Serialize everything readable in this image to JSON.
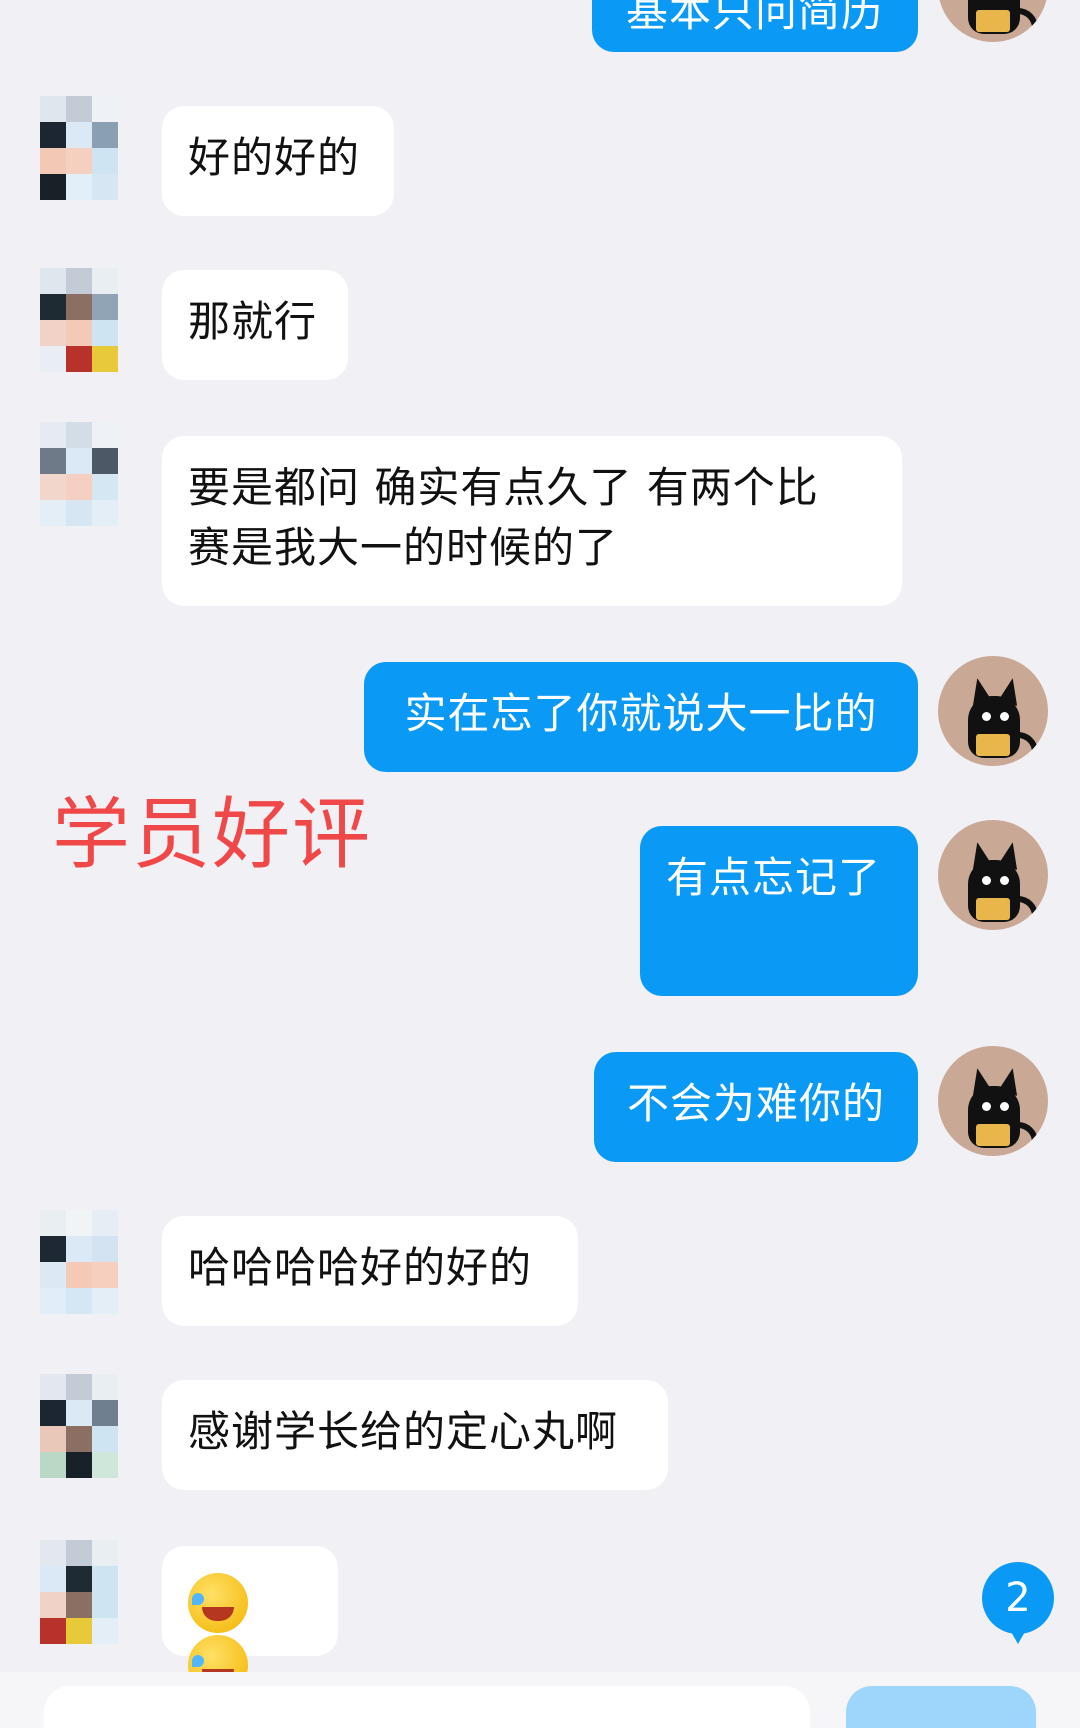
{
  "messages": [
    {
      "side": "out",
      "text": "基本只问简历"
    },
    {
      "side": "in",
      "text": "好的好的"
    },
    {
      "side": "in",
      "text": "那就行"
    },
    {
      "side": "in",
      "line1": "要是都问 确实有点久了 有两个比",
      "line2": "赛是我大一的时候的了"
    },
    {
      "side": "out",
      "text": "实在忘了你就说大一比的"
    },
    {
      "side": "out",
      "text": "有点忘记了"
    },
    {
      "side": "out",
      "text": "不会为难你的"
    },
    {
      "side": "in",
      "text": "哈哈哈哈好的好的"
    },
    {
      "side": "in",
      "text": "感谢学长给的定心丸啊"
    },
    {
      "side": "in",
      "emoji": [
        "rolling-on-floor-laughing",
        "rolling-on-floor-laughing"
      ]
    }
  ],
  "overlay": {
    "text": "学员好评",
    "color": "#f04848"
  },
  "unread_badge": "2",
  "input": {
    "send_label": ""
  },
  "colors": {
    "outgoing": "#0a99f5",
    "incoming": "#ffffff",
    "background": "#f0f0f5"
  }
}
